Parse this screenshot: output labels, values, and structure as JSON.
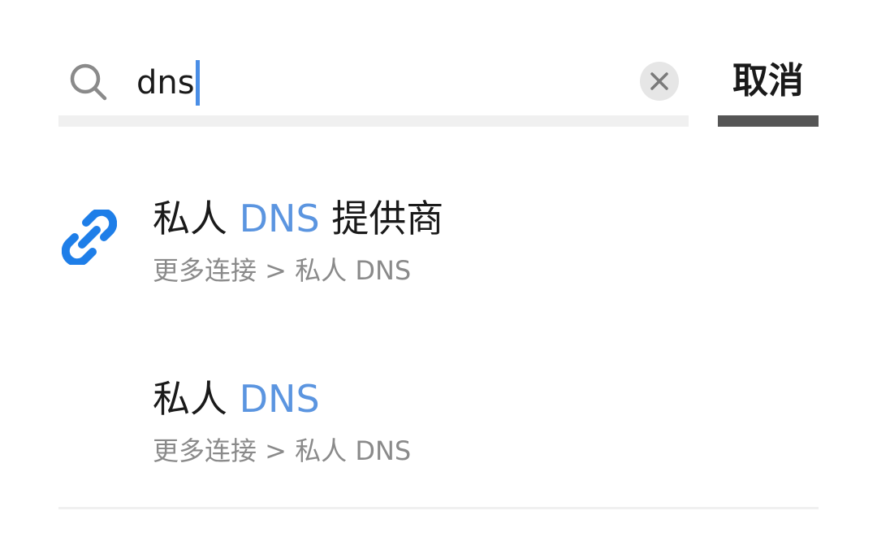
{
  "search": {
    "query": "dns"
  },
  "header": {
    "cancel_label": "取消"
  },
  "results": [
    {
      "title_prefix": "私人 ",
      "title_highlight": "DNS",
      "title_suffix": " 提供商",
      "path": "更多连接 > 私人 DNS",
      "icon": "link-icon"
    },
    {
      "title_prefix": "私人 ",
      "title_highlight": "DNS",
      "title_suffix": "",
      "path": "更多连接 > 私人 DNS",
      "icon": ""
    }
  ],
  "colors": {
    "highlight": "#5b95e0",
    "link_icon": "#1e7ee8",
    "caret": "#4a8ee6"
  }
}
